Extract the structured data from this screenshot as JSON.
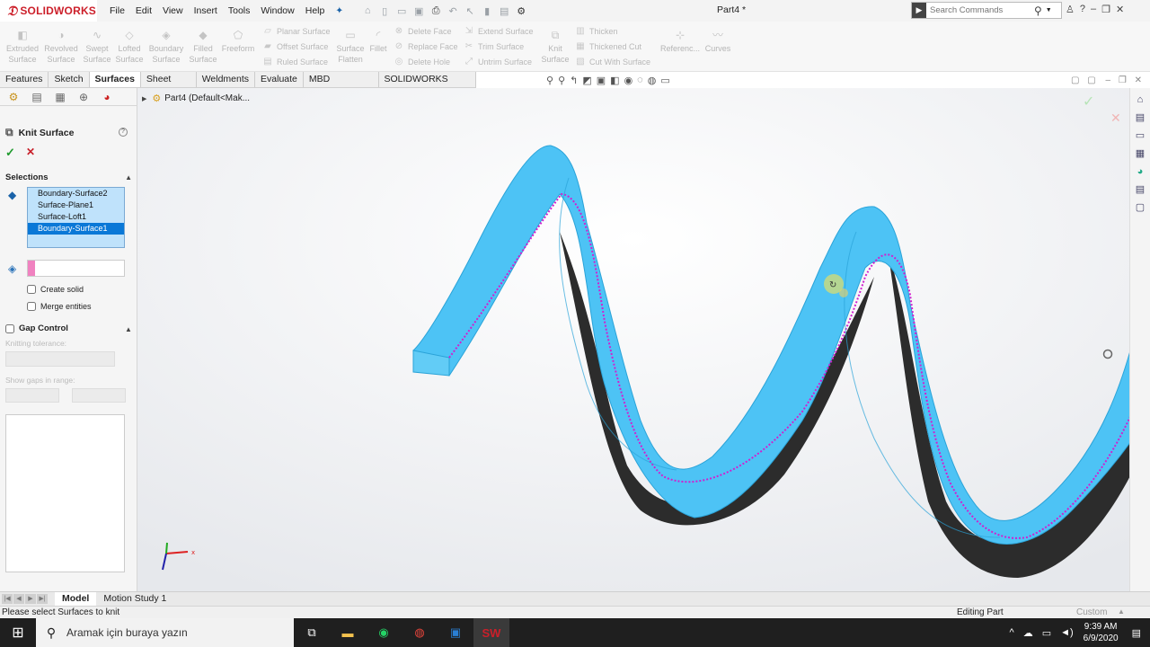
{
  "app": {
    "brand": "SOLIDWORKS",
    "document_title": "Part4 *"
  },
  "menu": [
    "File",
    "Edit",
    "View",
    "Insert",
    "Tools",
    "Window",
    "Help"
  ],
  "search": {
    "placeholder": "Search Commands"
  },
  "ribbon": {
    "big_buttons": [
      {
        "label1": "Extruded",
        "label2": "Surface",
        "icon": "extruded-surface-icon"
      },
      {
        "label1": "Revolved",
        "label2": "Surface",
        "icon": "revolved-surface-icon"
      },
      {
        "label1": "Swept",
        "label2": "Surface",
        "icon": "swept-surface-icon"
      },
      {
        "label1": "Lofted",
        "label2": "Surface",
        "icon": "lofted-surface-icon"
      },
      {
        "label1": "Boundary",
        "label2": "Surface",
        "icon": "boundary-surface-icon"
      },
      {
        "label1": "Filled",
        "label2": "Surface",
        "icon": "filled-surface-icon"
      },
      {
        "label1": "Freeform",
        "label2": "",
        "icon": "freeform-icon"
      }
    ],
    "col1": [
      "Planar Surface",
      "Offset Surface",
      "Ruled Surface"
    ],
    "flatten": {
      "label1": "Surface",
      "label2": "Flatten"
    },
    "fillet": "Fillet",
    "col2": [
      "Delete Face",
      "Replace Face",
      "Delete Hole"
    ],
    "col3": [
      "Extend Surface",
      "Trim Surface",
      "Untrim Surface"
    ],
    "knit": {
      "label1": "Knit",
      "label2": "Surface"
    },
    "col4": [
      "Thicken",
      "Thickened Cut",
      "Cut With Surface"
    ],
    "reference": "Referenc...",
    "curves": "Curves"
  },
  "tabs": [
    "Features",
    "Sketch",
    "Surfaces",
    "Sheet Metal",
    "Weldments",
    "Evaluate",
    "MBD Dimensions",
    "SOLIDWORKS Add-Ins"
  ],
  "active_tab": "Surfaces",
  "tree": {
    "label": "Part4  (Default<Mak..."
  },
  "property_manager": {
    "title": "Knit Surface",
    "selections_header": "Selections",
    "selections": [
      "Boundary-Surface2",
      "Surface-Plane1",
      "Surface-Loft1",
      "Boundary-Surface1"
    ],
    "selected_index": 3,
    "create_solid": "Create solid",
    "merge_entities": "Merge entities",
    "gap_control": "Gap Control",
    "knitting_tolerance": "Knitting tolerance:",
    "show_gaps": "Show gaps in range:"
  },
  "bottom_tabs": [
    "Model",
    "Motion Study 1"
  ],
  "status": {
    "message": "Please select Surfaces to knit",
    "mode": "Editing Part",
    "units": "Custom"
  },
  "taskbar": {
    "search_placeholder": "Aramak için buraya yazın",
    "time": "9:39 AM",
    "date": "6/9/2020"
  },
  "colors": {
    "surface": "#4dc3f5",
    "surface_dark": "#2a2a2a",
    "edge": "#d020d0",
    "brand_red": "#cc1f2a",
    "selection": "#0a78d7"
  }
}
